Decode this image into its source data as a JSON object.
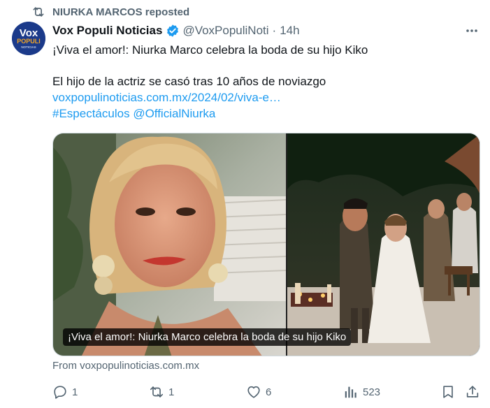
{
  "repost": {
    "label": "NIURKA MARCOS reposted",
    "icon": "repost-icon"
  },
  "author": {
    "name": "Vox Populi Noticias",
    "handle": "@VoxPopuliNoti",
    "separator": "·",
    "time": "14h",
    "verified_icon": "verified-badge-icon",
    "avatar_text_top": "Vox",
    "avatar_text_mid": "POPULI",
    "avatar_text_bottom": "NOTICIAS"
  },
  "tweet": {
    "headline": "¡Viva el amor!: Niurka Marco celebra la boda de su hijo Kiko",
    "body": "El hijo de la actriz se casó tras 10 años de noviazgo",
    "link": "voxpopulinoticias.com.mx/2024/02/viva-e…",
    "hashtag": "#Espectáculos",
    "mention": "@OfficialNiurka"
  },
  "card": {
    "caption": "¡Viva el amor!: Niurka Marco celebra la boda de su hijo Kiko",
    "source": "From voxpopulinoticias.com.mx"
  },
  "actions": {
    "reply_count": "1",
    "repost_count": "1",
    "like_count": "6",
    "views_count": "523"
  },
  "colors": {
    "accent": "#1d9bf0",
    "muted": "#536471",
    "text": "#0f1419"
  }
}
